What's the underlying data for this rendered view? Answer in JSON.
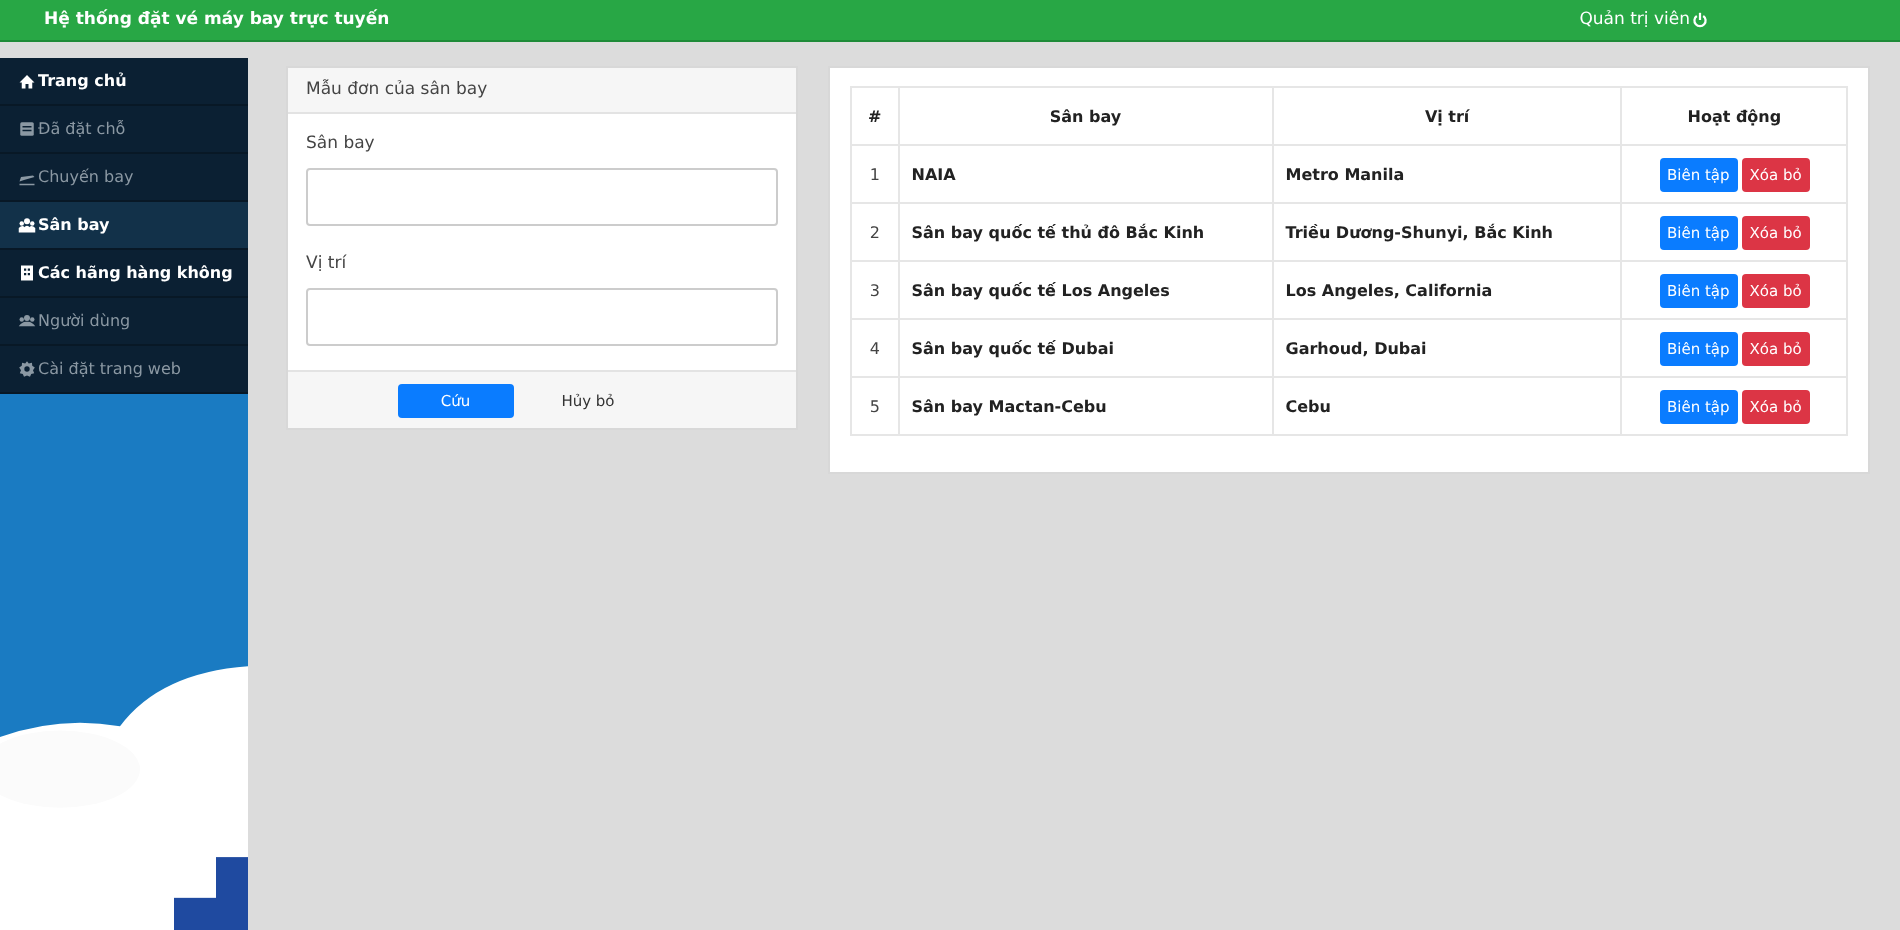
{
  "header": {
    "title": "Hệ thống đặt vé máy bay trực tuyến",
    "user": "Quản trị viên"
  },
  "sidebar": {
    "items": [
      {
        "label": "Trang chủ",
        "kind": "home",
        "dimmed": false,
        "selected": false
      },
      {
        "label": "Đã đặt chỗ",
        "kind": "book",
        "dimmed": true,
        "selected": false
      },
      {
        "label": "Chuyến bay",
        "kind": "plane",
        "dimmed": true,
        "selected": false
      },
      {
        "label": "Sân bay",
        "kind": "group",
        "dimmed": false,
        "selected": true
      },
      {
        "label": "Các hãng hàng không",
        "kind": "building",
        "dimmed": false,
        "selected": false
      },
      {
        "label": "Người dùng",
        "kind": "users",
        "dimmed": true,
        "selected": false
      },
      {
        "label": "Cài đặt trang web",
        "kind": "gear",
        "dimmed": true,
        "selected": false
      }
    ]
  },
  "form": {
    "title": "Mẫu đơn của sân bay",
    "fields": [
      {
        "label": "Sân bay"
      },
      {
        "label": "Vị trí"
      }
    ],
    "save": "Cứu",
    "cancel": "Hủy bỏ"
  },
  "table": {
    "columns": [
      "#",
      "Sân bay",
      "Vị trí",
      "Hoạt động"
    ],
    "rows": [
      {
        "index": "1",
        "airport": "NAIA",
        "location": "Metro Manila",
        "edit": "Biên tập",
        "delete": "Xóa bỏ"
      },
      {
        "index": "2",
        "airport": "Sân bay quốc tế thủ đô Bắc Kinh",
        "location": "Triều Dương-Shunyi, Bắc Kinh",
        "edit": "Biên tập",
        "delete": "Xóa bỏ"
      },
      {
        "index": "3",
        "airport": "Sân bay quốc tế Los Angeles",
        "location": "Los Angeles, California",
        "edit": "Biên tập",
        "delete": "Xóa bỏ"
      },
      {
        "index": "4",
        "airport": "Sân bay quốc tế Dubai",
        "location": "Garhoud, Dubai",
        "edit": "Biên tập",
        "delete": "Xóa bỏ"
      },
      {
        "index": "5",
        "airport": "Sân bay Mactan-Cebu",
        "location": "Cebu",
        "edit": "Biên tập",
        "delete": "Xóa bỏ"
      }
    ]
  }
}
